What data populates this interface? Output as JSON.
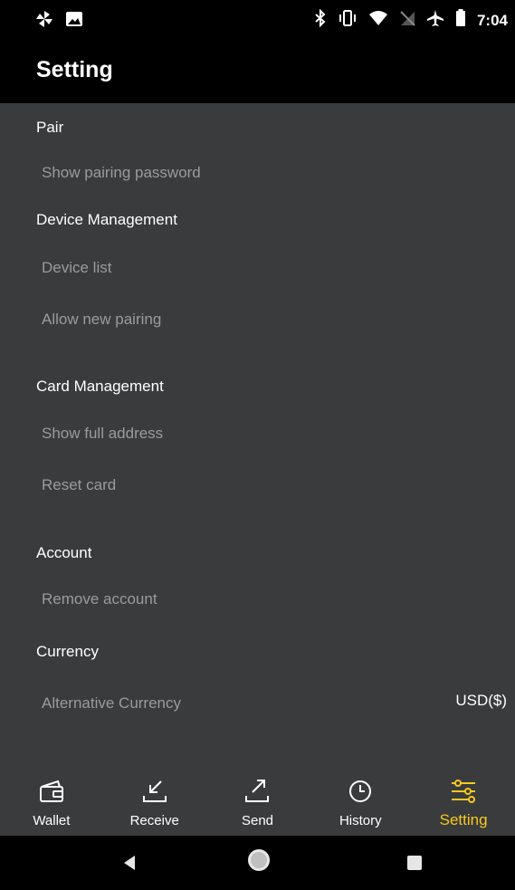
{
  "status_bar": {
    "time": "7:04",
    "left_icons": [
      "pinwheel-icon",
      "image-icon"
    ],
    "right_icons": [
      "bluetooth-icon",
      "vibrate-icon",
      "wifi-icon",
      "no-sim-icon",
      "airplane-icon",
      "battery-icon"
    ]
  },
  "header": {
    "title": "Setting"
  },
  "sections": {
    "pair": {
      "title": "Pair",
      "items": [
        "Show pairing password"
      ]
    },
    "device": {
      "title": "Device Management",
      "items": [
        "Device list",
        "Allow new pairing"
      ]
    },
    "card": {
      "title": "Card Management",
      "items": [
        "Show full address",
        "Reset card"
      ]
    },
    "account": {
      "title": "Account",
      "items": [
        "Remove account"
      ]
    },
    "currency": {
      "title": "Currency",
      "items": [
        "Alternative Currency"
      ],
      "value": "USD($)"
    }
  },
  "bottom_nav": {
    "active": "Setting",
    "accent_color": "#f6c91f",
    "items": [
      {
        "label": "Wallet",
        "icon": "wallet-icon"
      },
      {
        "label": "Receive",
        "icon": "receive-arrow-icon"
      },
      {
        "label": "Send",
        "icon": "send-arrow-icon"
      },
      {
        "label": "History",
        "icon": "clock-icon"
      },
      {
        "label": "Setting",
        "icon": "sliders-icon"
      }
    ]
  },
  "system_nav": {
    "icons": [
      "back-icon",
      "home-icon",
      "recents-icon"
    ]
  }
}
